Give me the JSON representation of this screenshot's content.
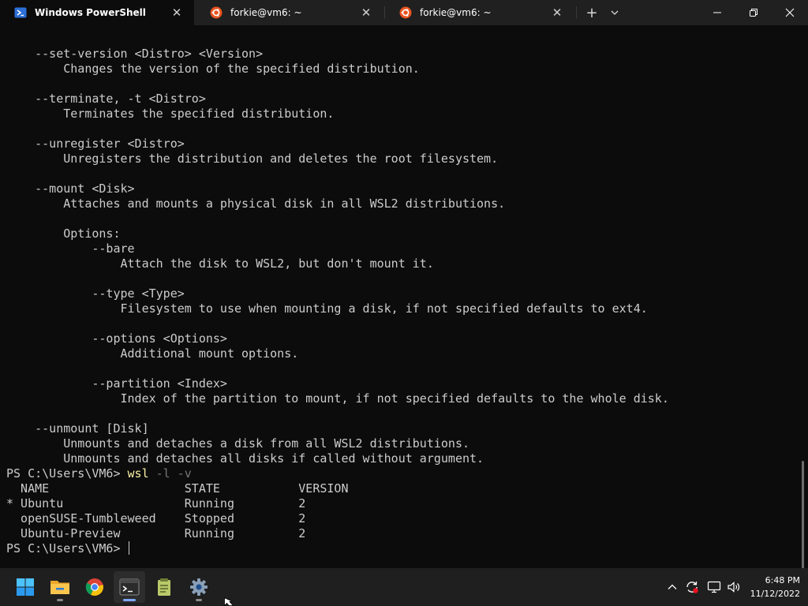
{
  "window": {
    "tabs": [
      {
        "label": "Windows PowerShell",
        "icon": "powershell-icon",
        "active": true
      },
      {
        "label": "forkie@vm6: ~",
        "icon": "ubuntu-icon",
        "active": false
      },
      {
        "label": "forkie@vm6: ~",
        "icon": "ubuntu-icon",
        "active": false
      }
    ],
    "new_tab_icon": "plus-icon",
    "dropdown_icon": "chevron-down-icon",
    "controls": [
      "minimize-icon",
      "restore-icon",
      "close-icon"
    ]
  },
  "terminal": {
    "lines": [
      "    --set-version <Distro> <Version>",
      "        Changes the version of the specified distribution.",
      "",
      "    --terminate, -t <Distro>",
      "        Terminates the specified distribution.",
      "",
      "    --unregister <Distro>",
      "        Unregisters the distribution and deletes the root filesystem.",
      "",
      "    --mount <Disk>",
      "        Attaches and mounts a physical disk in all WSL2 distributions.",
      "",
      "        Options:",
      "            --bare",
      "                Attach the disk to WSL2, but don't mount it.",
      "",
      "            --type <Type>",
      "                Filesystem to use when mounting a disk, if not specified defaults to ext4.",
      "",
      "            --options <Options>",
      "                Additional mount options.",
      "",
      "            --partition <Index>",
      "                Index of the partition to mount, if not specified defaults to the whole disk.",
      "",
      "    --unmount [Disk]",
      "        Unmounts and detaches a disk from all WSL2 distributions.",
      "        Unmounts and detaches all disks if called without argument."
    ],
    "command": {
      "prompt": "PS C:\\Users\\VM6> ",
      "cmd": "wsl",
      "args": " -l -v"
    },
    "distro_table": {
      "header": "  NAME                   STATE           VERSION",
      "rows": [
        "* Ubuntu                 Running         2",
        "  openSUSE-Tumbleweed    Stopped         2",
        "  Ubuntu-Preview         Running         2"
      ]
    },
    "final_prompt": "PS C:\\Users\\VM6> "
  },
  "taskbar": {
    "apps": [
      {
        "name": "start-button",
        "icon": "windows-logo-icon"
      },
      {
        "name": "file-explorer",
        "icon": "folder-icon"
      },
      {
        "name": "chrome",
        "icon": "chrome-icon"
      },
      {
        "name": "terminal",
        "icon": "terminal-icon"
      },
      {
        "name": "notepad",
        "icon": "notepad-icon"
      },
      {
        "name": "settings",
        "icon": "gear-icon"
      }
    ],
    "tray": [
      "chevron-up-icon",
      "sync-icon",
      "network-icon",
      "volume-icon"
    ],
    "clock": {
      "time": "6:48 PM",
      "date": "11/12/2022"
    }
  },
  "colors": {
    "terminal_bg": "#0c0c0c",
    "terminal_fg": "#cccccc",
    "command": "#f9f1a5",
    "args": "#767676",
    "tabbar_bg": "#202020",
    "taskbar_bg": "#1f1f1f"
  }
}
